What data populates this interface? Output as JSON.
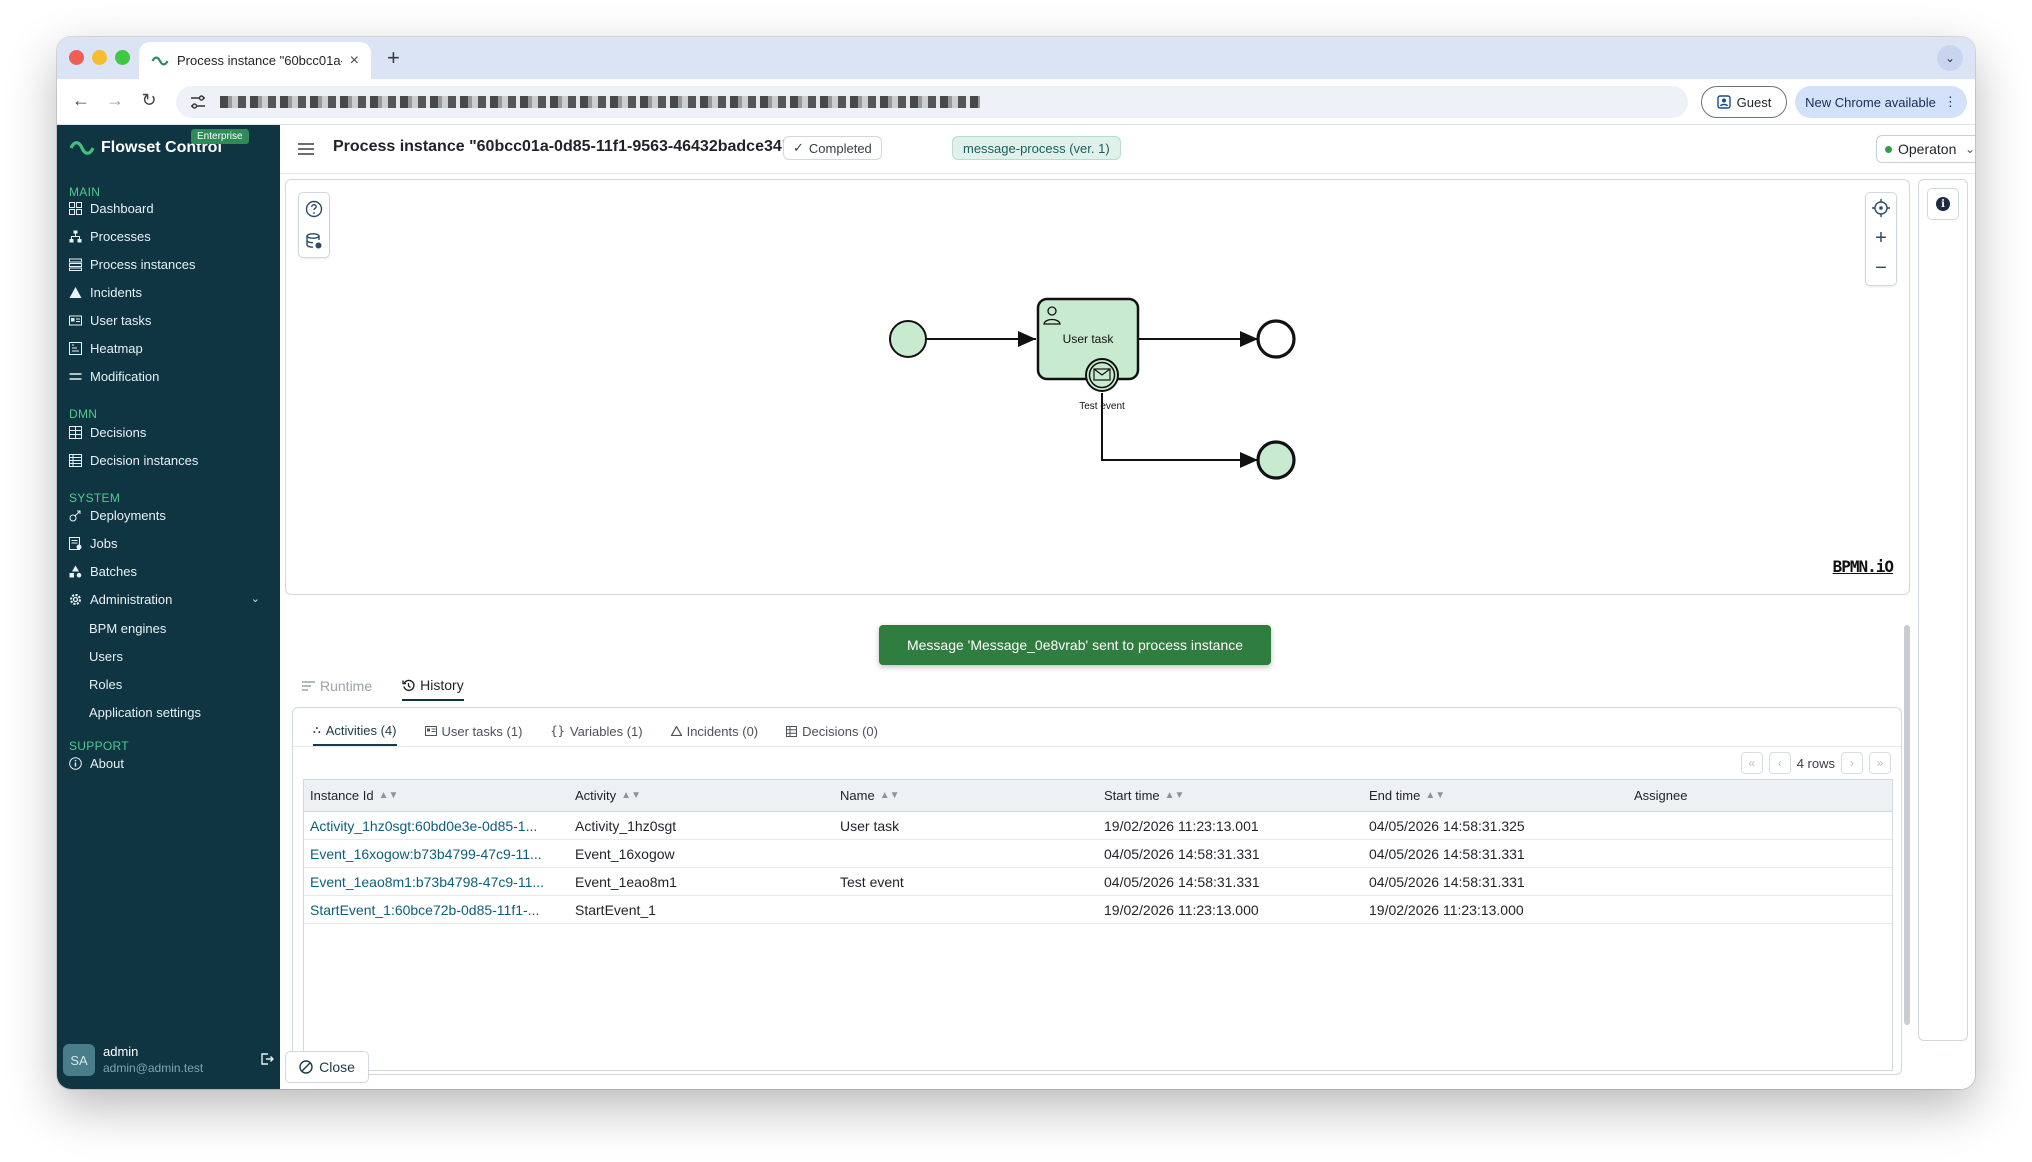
{
  "browser": {
    "tab_title": "Process instance \"60bcc01a-",
    "new_tab": "+",
    "guest_label": "Guest",
    "new_chrome_label": "New Chrome available"
  },
  "sidebar": {
    "brand": "Flowset Control",
    "badge": "Enterprise",
    "sections": {
      "main": "MAIN",
      "dmn": "DMN",
      "system": "SYSTEM",
      "support": "SUPPORT"
    },
    "main_items": [
      "Dashboard",
      "Processes",
      "Process instances",
      "Incidents",
      "User tasks",
      "Heatmap",
      "Modification"
    ],
    "dmn_items": [
      "Decisions",
      "Decision instances"
    ],
    "system_items": [
      "Deployments",
      "Jobs",
      "Batches"
    ],
    "administration": "Administration",
    "admin_items": [
      "BPM engines",
      "Users",
      "Roles",
      "Application settings"
    ],
    "support_items": [
      "About"
    ],
    "user": {
      "initials": "SA",
      "name": "admin",
      "email": "admin@admin.test"
    }
  },
  "header": {
    "title": "Process instance \"60bcc01a-0d85-11f1-9563-46432badce34\"",
    "status": "Completed",
    "process": "message-process (ver. 1)",
    "engine": "Operaton"
  },
  "diagram": {
    "task_label": "User task",
    "event_label": "Test event",
    "watermark": "BPMN.iO"
  },
  "toast": "Message 'Message_0e8vrab' sent to process instance",
  "tabs": {
    "runtime": "Runtime",
    "history": "History"
  },
  "subtabs": [
    "Activities (4)",
    "User tasks (1)",
    "Variables (1)",
    "Incidents (0)",
    "Decisions (0)"
  ],
  "pager": {
    "rows": "4 rows"
  },
  "table": {
    "columns": [
      "Instance Id",
      "Activity",
      "Name",
      "Start time",
      "End time",
      "Assignee"
    ],
    "rows": [
      [
        "Activity_1hz0sgt:60bd0e3e-0d85-1...",
        "Activity_1hz0sgt",
        "User task",
        "19/02/2026 11:23:13.001",
        "04/05/2026 14:58:31.325",
        ""
      ],
      [
        "Event_16xogow:b73b4799-47c9-11...",
        "Event_16xogow",
        "",
        "04/05/2026 14:58:31.331",
        "04/05/2026 14:58:31.331",
        ""
      ],
      [
        "Event_1eao8m1:b73b4798-47c9-11...",
        "Event_1eao8m1",
        "Test event",
        "04/05/2026 14:58:31.331",
        "04/05/2026 14:58:31.331",
        ""
      ],
      [
        "StartEvent_1:60bce72b-0d85-11f1-...",
        "StartEvent_1",
        "",
        "19/02/2026 11:23:13.000",
        "19/02/2026 11:23:13.000",
        ""
      ]
    ]
  },
  "footer": {
    "close_label": "Close"
  },
  "colors": {
    "sidebar_bg": "#0f3442",
    "section_green": "#4ecb8d",
    "toast_bg": "#2f7d3f",
    "task_fill": "#c8ebd0",
    "link": "#0b5f7a"
  }
}
